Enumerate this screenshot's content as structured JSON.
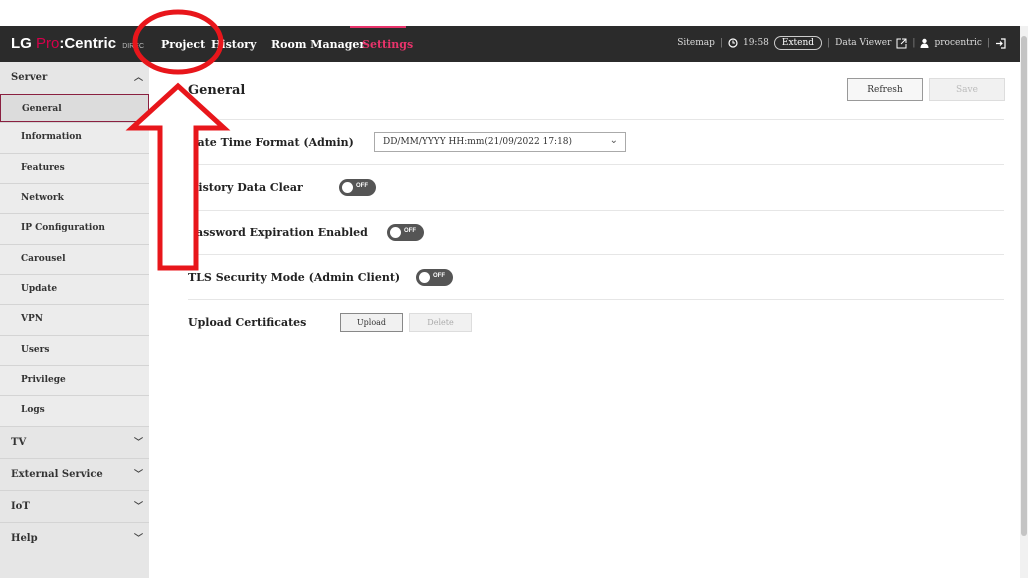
{
  "header": {
    "logo": {
      "lg": "LG",
      "pro": "Pro",
      "centric": ":Centric",
      "direct": "DIREC"
    },
    "nav": [
      "Project",
      "History",
      "Room Manager",
      "Settings"
    ],
    "active_nav": "Settings",
    "tools": {
      "sitemap": "Sitemap",
      "time": "19:58",
      "extend": "Extend",
      "data_viewer": "Data Viewer",
      "user": "procentric"
    }
  },
  "sidebar": {
    "server_label": "Server",
    "server_items": [
      "General",
      "Information",
      "Features",
      "Network",
      "IP Configuration",
      "Carousel",
      "Update",
      "VPN",
      "Users",
      "Privilege",
      "Logs"
    ],
    "active_item": "General",
    "other_sections": [
      "TV",
      "External Service",
      "IoT",
      "Help"
    ]
  },
  "main": {
    "title": "General",
    "refresh_label": "Refresh",
    "save_label": "Save",
    "date_time_label": "Date Time Format (Admin)",
    "date_time_value": "DD/MM/YYYY HH:mm(21/09/2022 17:18)",
    "history_label": "History Data Clear",
    "history_state": "OFF",
    "password_label": "Password Expiration Enabled",
    "password_state": "OFF",
    "tls_label": "TLS Security Mode (Admin Client)",
    "tls_state": "OFF",
    "upload_cert_label": "Upload Certificates",
    "upload_label": "Upload",
    "delete_label": "Delete"
  },
  "annotation": {
    "color": "#e8161b"
  }
}
